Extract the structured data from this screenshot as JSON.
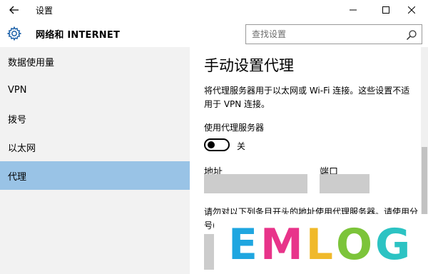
{
  "window": {
    "title": "设置"
  },
  "header": {
    "section_title": "网络和 INTERNET",
    "search_placeholder": "查找设置"
  },
  "sidebar": {
    "items": [
      {
        "label": "数据使用量",
        "selected": false
      },
      {
        "label": "VPN",
        "selected": false
      },
      {
        "label": "拨号",
        "selected": false
      },
      {
        "label": "以太网",
        "selected": false
      },
      {
        "label": "代理",
        "selected": true
      }
    ]
  },
  "content": {
    "heading": "手动设置代理",
    "description": "将代理服务器用于以太网或 Wi-Fi 连接。这些设置不适用于 VPN 连接。",
    "toggle_label": "使用代理服务器",
    "toggle_state": "关",
    "toggle_on": false,
    "address_label": "地址",
    "address_value": "",
    "port_label": "端口",
    "port_value": "",
    "exclude_description": "请勿对以下列条目开头的地址使用代理服务器。请使用分号(;)来分隔各个条目。",
    "exclude_value": ""
  },
  "watermark": {
    "letters": [
      {
        "char": "E",
        "color": "#1fa6e0"
      },
      {
        "char": "M",
        "color": "#e8348a"
      },
      {
        "char": "L",
        "color": "#f0b92a"
      },
      {
        "char": "O",
        "color": "#7cc43a"
      },
      {
        "char": "G",
        "color": "#2cc3c3"
      }
    ]
  },
  "colors": {
    "selected_nav": "#99c3e6",
    "sidebar_bg": "#f2f2f2",
    "input_fill": "#cccccc"
  }
}
